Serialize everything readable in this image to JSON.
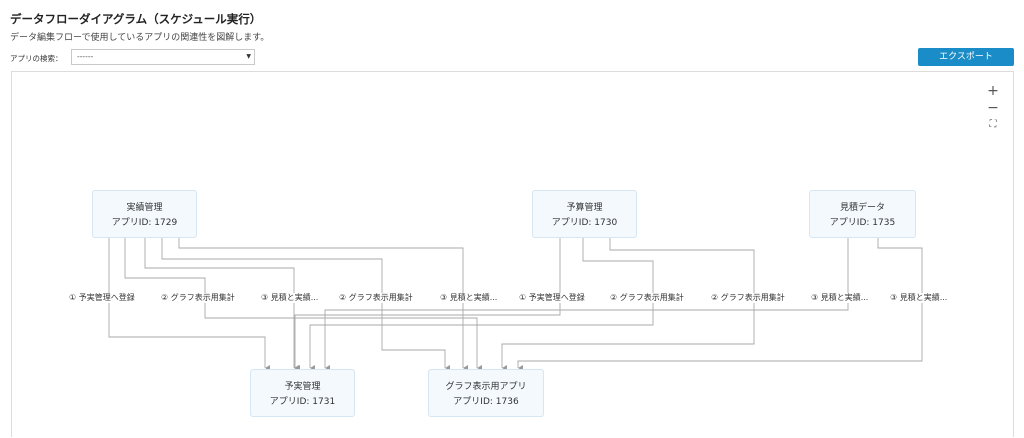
{
  "header": {
    "title": "データフローダイアグラム（スケジュール実行）",
    "subtitle": "データ編集フローで使用しているアプリの関連性を図解します。"
  },
  "search": {
    "label": "アプリの検索：",
    "value": "------"
  },
  "toolbar": {
    "export_label": "エクスポート"
  },
  "zoom_controls": {
    "zoom_in": "+",
    "zoom_out": "−",
    "fit": "⛶"
  },
  "nodes": {
    "n1729": {
      "title": "実績管理",
      "id_text": "アプリID: 1729"
    },
    "n1730": {
      "title": "予算管理",
      "id_text": "アプリID: 1730"
    },
    "n1735": {
      "title": "見積データ",
      "id_text": "アプリID: 1735"
    },
    "n1731": {
      "title": "予実管理",
      "id_text": "アプリID: 1731"
    },
    "n1736": {
      "title": "グラフ表示用アプリ",
      "id_text": "アプリID: 1736"
    }
  },
  "edge_labels": [
    "① 予実管理へ登録",
    "② グラフ表示用集計",
    "③ 見積と実績...",
    "② グラフ表示用集計",
    "③ 見積と実績...",
    "① 予実管理へ登録",
    "② グラフ表示用集計",
    "② グラフ表示用集計",
    "③ 見積と実績...",
    "③ 見積と実績..."
  ],
  "colors": {
    "accent": "#1a8cc7",
    "node_fill": "#f3f9fd",
    "edge": "#999999"
  }
}
